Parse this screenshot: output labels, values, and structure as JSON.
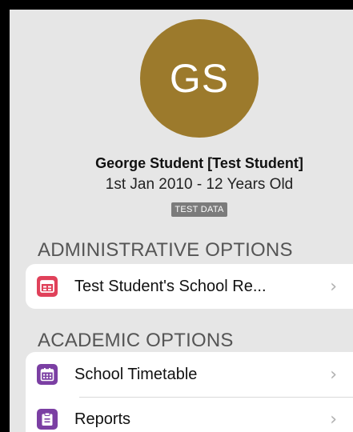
{
  "profile": {
    "initials": "GS",
    "avatar_color": "#9c7a2c",
    "name": "George Student [Test Student]",
    "dob": "1st Jan 2010 - 12 Years Old",
    "badge": "TEST DATA"
  },
  "sections": {
    "administrative": {
      "header": "ADMINISTRATIVE OPTIONS",
      "items": [
        {
          "label": "Test Student's School Re...",
          "icon": "school-report-icon",
          "icon_color": "#e0415a"
        }
      ]
    },
    "academic": {
      "header": "ACADEMIC OPTIONS",
      "items": [
        {
          "label": "School Timetable",
          "icon": "calendar-icon",
          "icon_color": "#7b3fa3"
        },
        {
          "label": "Reports",
          "icon": "clipboard-icon",
          "icon_color": "#7b3fa3"
        }
      ]
    }
  }
}
